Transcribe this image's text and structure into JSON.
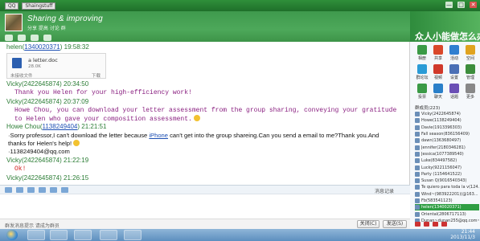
{
  "titlebar": {
    "tab1": "QQ",
    "tab2": "Shaingstuff",
    "win_buttons": [
      "—",
      "□",
      "✕"
    ]
  },
  "group": {
    "name": "Sharing & improving",
    "subtitle": "分享 提高 讨论 群",
    "banner": "众人小能做怎么办"
  },
  "messages": [
    {
      "sender": "helen",
      "qq": "1340020371",
      "time": "19:58:32",
      "type": "file",
      "file": {
        "name": "a letter.doc",
        "size": "28.0K",
        "status": "未接收文件",
        "action": "下载"
      }
    },
    {
      "sender": "Vicky",
      "qq": "2422645874",
      "time": "20:34:50",
      "text": "Thank you Helen for your high-efficiency work!"
    },
    {
      "sender": "Vicky",
      "qq": "2422645874",
      "time": "20:37:09",
      "text": "Howe Chou, you can download your letter assessment from the group sharing, conveying your gratitude",
      "text2": "to Helen who gave your composition assessment."
    },
    {
      "sender": "Howe Chou",
      "qq": "1138249404",
      "time": "21:21:51",
      "line1_pre": "·Sorry professor,I can't download the letter because ",
      "line1_link": "iPhone",
      "line1_post": " can't get into the group shareing.Can you send a email to me?Thank you.And",
      "line2": "thanks for Helen's help!",
      "line3": "·1138249404@qq.com"
    },
    {
      "sender": "Vicky",
      "qq": "2422645874",
      "time": "21:22:19",
      "text": "Ok!"
    },
    {
      "sender": "Vicky",
      "qq": "2422645874",
      "time": "21:26:15"
    }
  ],
  "compose": {
    "record_label": "消息记录",
    "hint": "群发消息提示 请成为群员",
    "close_button": "关闭(C)",
    "send_button": "发送(S)"
  },
  "apps": [
    {
      "label": "相册",
      "color": "#3a9a46"
    },
    {
      "label": "共享",
      "color": "#d9482b"
    },
    {
      "label": "活动",
      "color": "#2f7fd0"
    },
    {
      "label": "空间",
      "color": "#e0a31f"
    },
    {
      "label": "群论坛",
      "color": "#2a9bd6"
    },
    {
      "label": "视频",
      "color": "#d0392b"
    },
    {
      "label": "设置",
      "color": "#4a6fb5"
    },
    {
      "label": "管理",
      "color": "#3c8d3c"
    },
    {
      "label": "投票",
      "color": "#3a9a46"
    },
    {
      "label": "聊天",
      "color": "#2a7fc9"
    },
    {
      "label": "话题",
      "color": "#6a4fb5"
    },
    {
      "label": "更多",
      "color": "#888888"
    }
  ],
  "members_title": "群成员(223)",
  "members": [
    "Vicky(2422645874)",
    "Howe(1138249404)",
    "Davie(1913396303)",
    "Fall season(836156409)",
    "dawn(1363680497)",
    "Jennifer(2180346281)",
    "Jessica(1077389540)",
    "Luke(834497582)",
    "Lucky(9221156047)",
    "Party (1154641522)",
    "Susan Q(9016540343)",
    "Te quiero para toda la v(124...",
    "Wind~(983922201)(@163...",
    "Fb(583541123)",
    "helen(1340020371)",
    "Oriental(2806717113)",
    "Dunan~dunan255@qq.com~"
  ],
  "taskbar": {
    "time": "21:44",
    "date": "2013/11/3"
  }
}
